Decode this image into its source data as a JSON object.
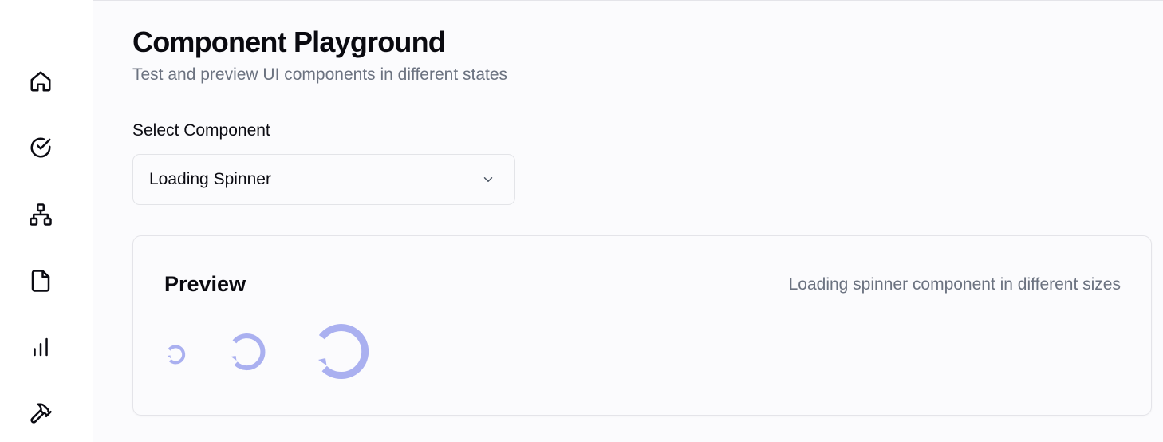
{
  "sidebar": {
    "items": [
      {
        "icon": "home-icon"
      },
      {
        "icon": "check-circle-icon"
      },
      {
        "icon": "sitemap-icon"
      },
      {
        "icon": "file-icon"
      },
      {
        "icon": "bar-chart-icon"
      },
      {
        "icon": "hammer-icon"
      }
    ]
  },
  "page": {
    "title": "Component Playground",
    "subtitle": "Test and preview UI components in different states"
  },
  "component_select": {
    "label": "Select Component",
    "value": "Loading Spinner",
    "icon": "chevron-down-icon"
  },
  "preview": {
    "title": "Preview",
    "description": "Loading spinner component in different sizes",
    "spinners": [
      "small",
      "medium",
      "large"
    ]
  },
  "colors": {
    "spinner": "#aab0f0",
    "icon": "#0b0b12",
    "muted_text": "#6b7280"
  }
}
